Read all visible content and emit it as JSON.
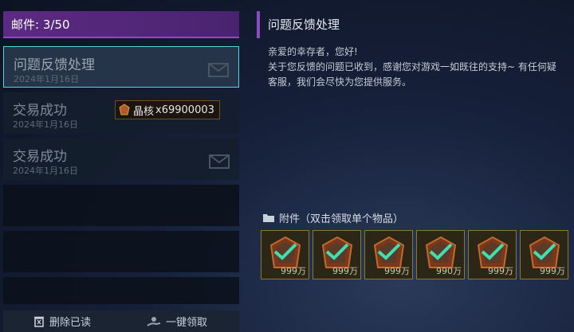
{
  "mail_header": "邮件: 3/50",
  "mails": [
    {
      "title": "问题反馈处理",
      "date": "2024年1月16日",
      "selected": true
    },
    {
      "title": "交易成功",
      "date": "2024年1月16日",
      "item_name": "晶核",
      "item_qty": "x69900003"
    },
    {
      "title": "交易成功",
      "date": "2024年1月16日"
    }
  ],
  "bottom": {
    "delete_read": "删除已读",
    "claim_all": "一键领取"
  },
  "detail": {
    "subject": "问题反馈处理",
    "greeting": "亲爱的幸存者，您好!",
    "body": "关于您反馈的问题已收到，感谢您对游戏一如既往的支持~ 有任何疑\n客服，我们会尽快为您提供服务。",
    "attachments_label": "附件（双击领取单个物品）",
    "attachments": [
      {
        "qty": "999万"
      },
      {
        "qty": "999万"
      },
      {
        "qty": "999万"
      },
      {
        "qty": "990万"
      },
      {
        "qty": "999万"
      },
      {
        "qty": "999万"
      }
    ]
  },
  "colors": {
    "accent_purple": "#5c2a82",
    "selected_border": "#4dd8e6",
    "check_green": "#3fe0b0"
  }
}
